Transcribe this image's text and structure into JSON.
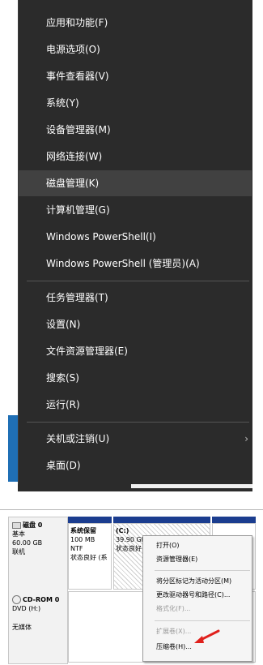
{
  "winx_menu": {
    "items": [
      {
        "label": "应用和功能(F)"
      },
      {
        "label": "电源选项(O)"
      },
      {
        "label": "事件查看器(V)"
      },
      {
        "label": "系统(Y)"
      },
      {
        "label": "设备管理器(M)"
      },
      {
        "label": "网络连接(W)"
      },
      {
        "label": "磁盘管理(K)",
        "highlighted": true
      },
      {
        "label": "计算机管理(G)"
      },
      {
        "label": "Windows PowerShell(I)"
      },
      {
        "label": "Windows PowerShell (管理员)(A)"
      },
      {
        "label": "任务管理器(T)"
      },
      {
        "label": "设置(N)"
      },
      {
        "label": "文件资源管理器(E)"
      },
      {
        "label": "搜索(S)"
      },
      {
        "label": "运行(R)"
      },
      {
        "label": "关机或注销(U)",
        "submenu_arrow": "›"
      },
      {
        "label": "桌面(D)"
      }
    ],
    "colors": {
      "background": "#2b2b2b",
      "highlight": "#414141",
      "text": "#ffffff"
    }
  },
  "disk_mgmt": {
    "disk0": {
      "name": "磁盘 0",
      "type": "基本",
      "size": "60.00 GB",
      "status": "联机"
    },
    "cdrom0": {
      "name": "CD-ROM 0",
      "type": "DVD (H:)",
      "media": "无媒体"
    },
    "partitions": [
      {
        "name": "系统保留",
        "size": "100 MB NTF",
        "status": "状态良好 (系"
      },
      {
        "name": "(C:)",
        "size": "39.90 GE",
        "status": "状态良好"
      }
    ],
    "context_menu": {
      "items": [
        {
          "label": "打开(O)",
          "enabled": true
        },
        {
          "label": "资源管理器(E)",
          "enabled": true
        },
        {
          "label": "将分区标记为活动分区(M)",
          "enabled": true
        },
        {
          "label": "更改驱动器号和路径(C)...",
          "enabled": true
        },
        {
          "label": "格式化(F)...",
          "enabled": false
        },
        {
          "label": "扩展卷(X)...",
          "enabled": false
        },
        {
          "label": "压缩卷(H)...",
          "enabled": true
        }
      ]
    },
    "colors": {
      "partition_header": "#1b3d8f",
      "arrow": "#e0201c"
    }
  }
}
